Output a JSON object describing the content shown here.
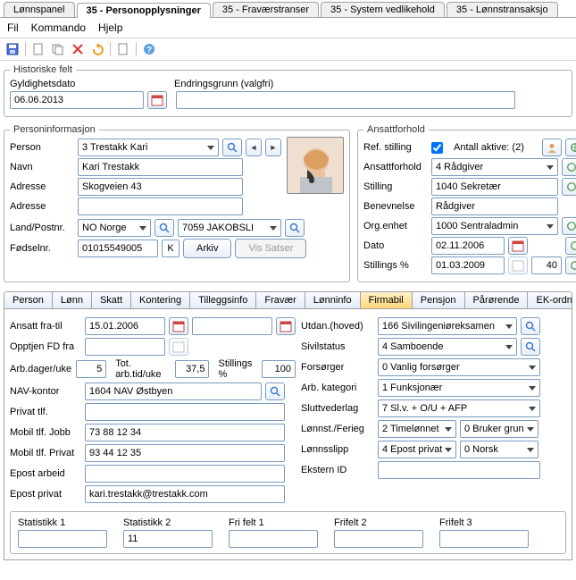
{
  "tabs": {
    "top": [
      "Lønnspanel",
      "35 - Personopplysninger",
      "35 - Fraværstranser",
      "35 - System vedlikehold",
      "35 - Lønnstransaksjo"
    ],
    "active": 1
  },
  "menu": {
    "file": "Fil",
    "command": "Kommando",
    "help": "Hjelp"
  },
  "hist": {
    "legend": "Historiske felt",
    "date_lbl": "Gyldighetsdato",
    "date": "06.06.2013",
    "reason_lbl": "Endringsgrunn (valgfri)"
  },
  "person": {
    "legend": "Personinformasjon",
    "person_lbl": "Person",
    "person": "3 Trestakk Kari",
    "name_lbl": "Navn",
    "name": "Kari Trestakk",
    "addr_lbl": "Adresse",
    "addr1": "Skogveien 43",
    "addr2": "",
    "country_lbl": "Land/Postnr.",
    "country": "NO Norge",
    "post": "7059 JAKOBSLI",
    "birth_lbl": "Fødselnr.",
    "birth": "01015549005",
    "k": "K",
    "arkiv": "Arkiv",
    "vis_satser": "Vis Satser"
  },
  "emp": {
    "legend": "Ansattforhold",
    "ref_lbl": "Ref. stilling",
    "active_lbl": "Antall aktive: (2)",
    "forhold_lbl": "Ansattforhold",
    "forhold": "4 Rådgiver",
    "stilling_lbl": "Stilling",
    "stilling": "1040 Sekretær",
    "benevn_lbl": "Benevnelse",
    "benevn": "Rådgiver",
    "org_lbl": "Org.enhet",
    "org": "1000 Sentraladmin",
    "dato_lbl": "Dato",
    "dato": "02.11.2006",
    "pct_lbl": "Stillings %",
    "pct_date": "01.03.2009",
    "pct": "40"
  },
  "subtabs": [
    "Person",
    "Lønn",
    "Skatt",
    "Kontering",
    "Tilleggsinfo",
    "Fravær",
    "Lønninfo",
    "Firmabil",
    "Pensjon",
    "Pårørende",
    "EK-ordnin"
  ],
  "subtab_active": 7,
  "detail": {
    "ansatt_lbl": "Ansatt fra-til",
    "ansatt_from": "15.01.2006",
    "opptj_lbl": "Opptjen FD fra",
    "arb_lbl": "Arb.dager/uke",
    "arb_dager": "5",
    "tot_lbl": "Tot. arb.tid/uke",
    "tot": "37,5",
    "st_pct_lbl": "Stillings %",
    "st_pct": "100",
    "nav_lbl": "NAV-kontor",
    "nav": "1604 NAV Østbyen",
    "priv_tlf_lbl": "Privat tlf.",
    "mob_jobb_lbl": "Mobil tlf. Jobb",
    "mob_jobb": "73 88 12 34",
    "mob_priv_lbl": "Mobil tlf. Privat",
    "mob_priv": "93 44 12 35",
    "ep_arbeid_lbl": "Epost arbeid",
    "ep_priv_lbl": "Epost privat",
    "ep_priv": "kari.trestakk@trestakk.com",
    "utdan_lbl": "Utdan.(hoved)",
    "utdan": "166 Sivilingeniøreksamen",
    "sivil_lbl": "Sivilstatus",
    "sivil": "4 Samboende",
    "fors_lbl": "Forsørger",
    "fors": "0 Vanlig forsørger",
    "kat_lbl": "Arb. kategori",
    "kat": "1 Funksjonær",
    "slutt_lbl": "Sluttvederlag",
    "slutt": "7 Sl.v. + O/U + AFP",
    "lonnst_lbl": "Lønnst./Ferieg",
    "lonnst1": "2 Timelønnet",
    "lonnst2": "0 Bruker grun",
    "slip_lbl": "Lønnsslipp",
    "slip1": "4 Epost privat",
    "slip2": "0 Norsk",
    "eksid_lbl": "Ekstern ID"
  },
  "stats": {
    "s1_lbl": "Statistikk 1",
    "s1": "",
    "s2_lbl": "Statistikk 2",
    "s2": "11",
    "f1_lbl": "Fri felt 1",
    "f1": "",
    "f2_lbl": "Frifelt 2",
    "f2": "",
    "f3_lbl": "Frifelt 3",
    "f3": ""
  }
}
